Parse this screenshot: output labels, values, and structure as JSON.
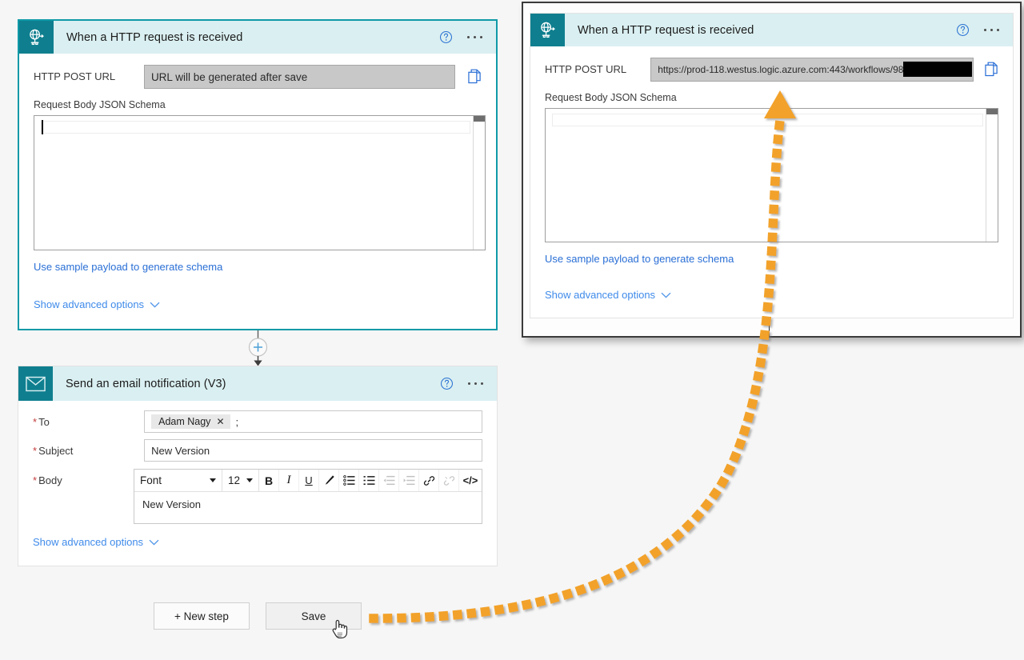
{
  "trigger_card": {
    "title": "When a HTTP request is received",
    "icon": "globe-network-icon",
    "help_icon": "help-circle-icon",
    "more_icon": "more-options-icon",
    "url_label": "HTTP POST URL",
    "url_value": "URL will be generated after save",
    "copy_icon": "copy-icon",
    "schema_label": "Request Body JSON Schema",
    "schema_value": "",
    "sample_payload_link": "Use sample payload to generate schema",
    "advanced_link": "Show advanced options",
    "advanced_chevron": "chevron-down-icon",
    "border_color": "#0f9aa8",
    "header_color": "#daeff1",
    "icon_color": "#0f7f8f"
  },
  "connector": {
    "add_icon": "plus-circle-icon",
    "arrow_icon": "arrow-down-icon"
  },
  "email_card": {
    "title": "Send an email notification (V3)",
    "icon": "envelope-icon",
    "help_icon": "help-circle-icon",
    "more_icon": "more-options-icon",
    "to_label": "To",
    "to_required": "*",
    "to_chip": "Adam Nagy",
    "to_chip_remove_icon": "close-icon",
    "to_separator": ";",
    "subject_label": "Subject",
    "subject_required": "*",
    "subject_value": "New Version",
    "body_label": "Body",
    "body_required": "*",
    "body_value": "New Version",
    "advanced_link": "Show advanced options",
    "advanced_chevron": "chevron-down-icon",
    "toolbar": {
      "font_name": "Font",
      "font_size": "12",
      "buttons": [
        {
          "name": "bold-button",
          "glyph": "B",
          "label": "B",
          "dim": false,
          "style": "bold"
        },
        {
          "name": "italic-button",
          "glyph": "I",
          "label": "I",
          "dim": false,
          "style": "italic"
        },
        {
          "name": "underline-button",
          "glyph": "U",
          "label": "U",
          "dim": false,
          "style": "underline"
        },
        {
          "name": "text-color-pen-button",
          "glyph": "pen-icon",
          "dim": false,
          "style": "svg"
        },
        {
          "name": "numbered-list-button",
          "glyph": "numbered-list-icon",
          "dim": false,
          "style": "svg"
        },
        {
          "name": "bullet-list-button",
          "glyph": "bullet-list-icon",
          "dim": false,
          "style": "svg"
        },
        {
          "name": "outdent-button",
          "glyph": "outdent-icon",
          "dim": true,
          "style": "svg"
        },
        {
          "name": "indent-button",
          "glyph": "indent-icon",
          "dim": true,
          "style": "svg"
        },
        {
          "name": "insert-link-button",
          "glyph": "link-icon",
          "dim": false,
          "style": "svg"
        },
        {
          "name": "remove-link-button",
          "glyph": "unlink-icon",
          "dim": true,
          "style": "svg"
        },
        {
          "name": "code-view-button",
          "glyph": "</>",
          "label": "</>",
          "dim": false,
          "style": "code"
        }
      ]
    }
  },
  "footer": {
    "new_step_label": "+ New step",
    "save_label": "Save"
  },
  "float_panel": {
    "title": "When a HTTP request is received",
    "icon": "globe-network-icon",
    "help_icon": "help-circle-icon",
    "more_icon": "more-options-icon",
    "url_label": "HTTP POST URL",
    "url_value": "https://prod-118.westus.logic.azure.com:443/workflows/98",
    "url_redacted": true,
    "copy_icon": "copy-icon",
    "schema_label": "Request Body JSON Schema",
    "sample_payload_link": "Use sample payload to generate schema",
    "advanced_link": "Show advanced options",
    "advanced_chevron": "chevron-down-icon"
  },
  "annotation": {
    "arrow_icon": "curved-dotted-arrow-icon",
    "arrow_color": "#F2A22C",
    "from": "save-button",
    "to": "http-post-url-value"
  },
  "cursor": {
    "icon": "pointing-hand-cursor"
  }
}
